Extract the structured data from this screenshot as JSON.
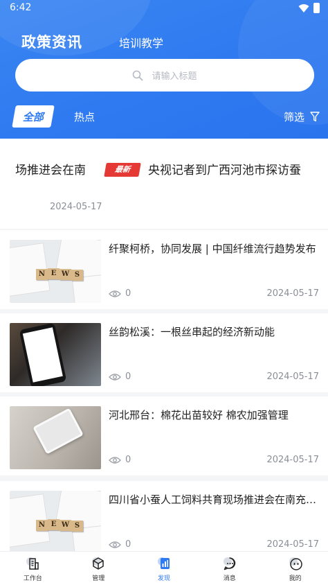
{
  "status_bar": {
    "time": "6:42"
  },
  "header": {
    "tab_active": "政策资讯",
    "tab_other": "培训教学"
  },
  "search": {
    "placeholder": "请输入标题"
  },
  "filter": {
    "chip_all": "全部",
    "chip_hot": "热点",
    "filter_label": "筛选"
  },
  "featured": {
    "text_left": "场推进会在南",
    "badge": "最新",
    "text_right": "央视记者到广西河池市探访蚕",
    "date": "2024-05-17"
  },
  "news": [
    {
      "title": "纤聚柯桥，协同发展 | 中国纤维流行趋势发布",
      "views": "0",
      "date": "2024-05-17",
      "thumb_tiles": [
        "N",
        "E",
        "W",
        "S"
      ]
    },
    {
      "title": "丝韵松溪：一根丝串起的经济新动能",
      "views": "0",
      "date": "2024-05-17"
    },
    {
      "title": "河北邢台：棉花出苗较好 棉农加强管理",
      "views": "0",
      "date": "2024-05-17"
    },
    {
      "title": "四川省小蚕人工饲料共育现场推进会在南充召开",
      "views": "0",
      "date": "2024-05-17",
      "thumb_tiles": [
        "N",
        "E",
        "W",
        "S"
      ]
    }
  ],
  "bottom_nav": [
    {
      "label": "工作台",
      "icon": "building-icon"
    },
    {
      "label": "管理",
      "icon": "cube-icon"
    },
    {
      "label": "发现",
      "icon": "discover-icon",
      "active": true
    },
    {
      "label": "消息",
      "icon": "message-icon"
    },
    {
      "label": "我的",
      "icon": "profile-icon"
    }
  ],
  "colors": {
    "primary": "#2f7af0",
    "badge_red": "#e53935",
    "text_muted": "#8a8f97"
  }
}
